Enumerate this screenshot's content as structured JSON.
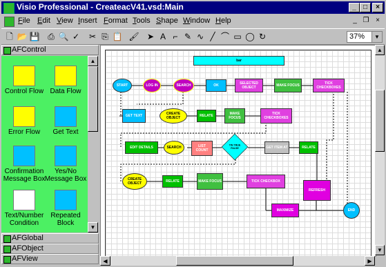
{
  "titlebar": {
    "title": "Visio Professional - CreateacV41.vsd:Main",
    "minimize": "_",
    "maximize": "□",
    "close": "×"
  },
  "menubar": {
    "items": [
      {
        "label": "File",
        "key": "F",
        "rest": "ile"
      },
      {
        "label": "Edit",
        "key": "E",
        "rest": "dit"
      },
      {
        "label": "View",
        "key": "V",
        "rest": "iew"
      },
      {
        "label": "Insert",
        "key": "I",
        "rest": "nsert"
      },
      {
        "label": "Format",
        "key": "F",
        "rest": "ormat"
      },
      {
        "label": "Tools",
        "key": "T",
        "rest": "ools"
      },
      {
        "label": "Shape",
        "key": "S",
        "rest": "hape"
      },
      {
        "label": "Window",
        "key": "W",
        "rest": "indow"
      },
      {
        "label": "Help",
        "key": "H",
        "rest": "elp"
      }
    ],
    "doc_minimize": "_",
    "doc_restore": "❐",
    "doc_close": "×"
  },
  "toolbar": {
    "zoom": "37%"
  },
  "stencil": {
    "active": "AFControl",
    "shapes": [
      {
        "label": "Control Flow",
        "color": "#ffff00"
      },
      {
        "label": "Data Flow",
        "color": "#ffff00"
      },
      {
        "label": "Error Flow",
        "color": "#ffff00"
      },
      {
        "label": "Get Text",
        "color": "#00c0ff"
      },
      {
        "label": "Confirmation Message Box",
        "color": "#00c0ff"
      },
      {
        "label": "Yes/No Message Box",
        "color": "#00c0ff"
      },
      {
        "label": "Text/Number Condition",
        "color": "#ffffff"
      },
      {
        "label": "Repeated Block",
        "color": "#00c0ff"
      }
    ],
    "others": [
      "AFGlobal",
      "AFObject",
      "AFView"
    ]
  },
  "diagram": {
    "header": "bar",
    "nodes": [
      {
        "label": "START",
        "color": "#00c0ff"
      },
      {
        "label": "LOG IN",
        "color": "#c000c0"
      },
      {
        "label": "SEARCH",
        "color": "#c000c0"
      },
      {
        "label": "OK",
        "color": "#00c0ff"
      },
      {
        "label": "SELECTED OBJECT",
        "color": "#e040e0"
      },
      {
        "label": "MAKE FOCUS",
        "color": "#40c040"
      },
      {
        "label": "TICK CHECKBOXES",
        "color": "#e040e0"
      },
      {
        "label": "GET TEXT",
        "color": "#00c0ff"
      },
      {
        "label": "CREATE OBJECT",
        "color": "#ffff00"
      },
      {
        "label": "RELATE",
        "color": "#00c000"
      },
      {
        "label": "MAKE FOCUS",
        "color": "#40c040"
      },
      {
        "label": "TICK CHECKBOXES",
        "color": "#e040e0"
      },
      {
        "label": "EDIT DETAILS",
        "color": "#00c000"
      },
      {
        "label": "SEARCH",
        "color": "#ffff00"
      },
      {
        "label": "LIST COUNT",
        "color": "#ff8080"
      },
      {
        "label": "TIN TRUE FALSE",
        "color": "#00ffff"
      },
      {
        "label": "GET ITEM AT",
        "color": "#c0c0c0"
      },
      {
        "label": "RELATE",
        "color": "#00c000"
      },
      {
        "label": "CREATE OBJECT",
        "color": "#ffff00"
      },
      {
        "label": "RELATE",
        "color": "#00c000"
      },
      {
        "label": "MAKE FOCUS",
        "color": "#40c040"
      },
      {
        "label": "TICK CHECKBOX",
        "color": "#e040e0"
      },
      {
        "label": "REFRESH",
        "color": "#e000e0"
      },
      {
        "label": "MAXIMIZE",
        "color": "#e000e0"
      },
      {
        "label": "END",
        "color": "#00c0ff"
      }
    ]
  }
}
